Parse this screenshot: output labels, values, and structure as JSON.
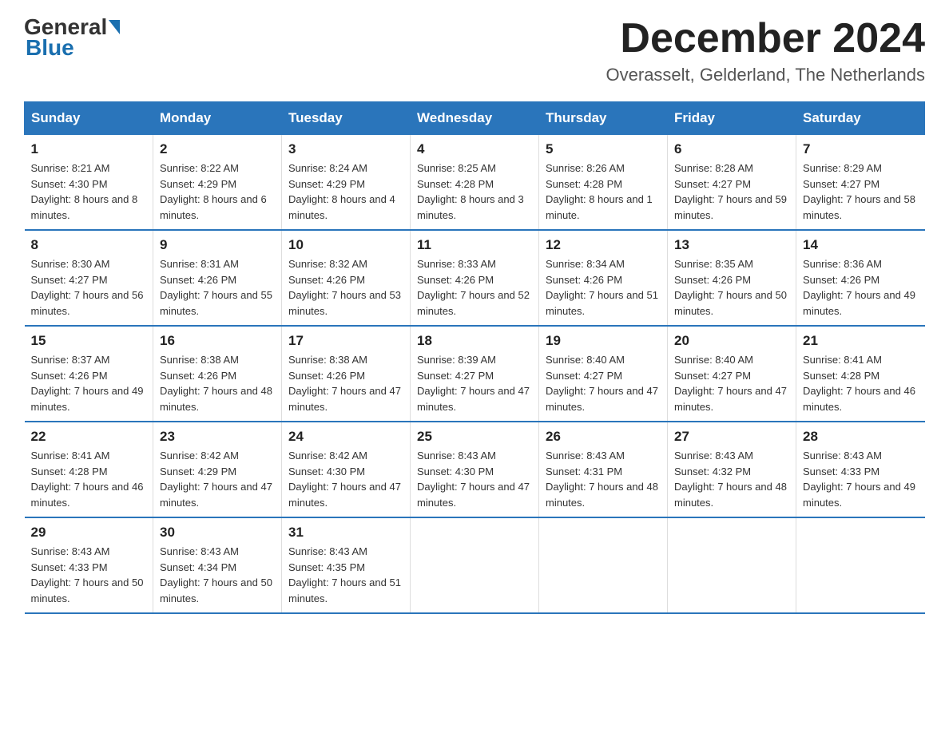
{
  "header": {
    "logo_text": "General",
    "logo_blue": "Blue",
    "month_title": "December 2024",
    "location": "Overasselt, Gelderland, The Netherlands"
  },
  "days_of_week": [
    "Sunday",
    "Monday",
    "Tuesday",
    "Wednesday",
    "Thursday",
    "Friday",
    "Saturday"
  ],
  "weeks": [
    [
      {
        "day": "1",
        "sunrise": "8:21 AM",
        "sunset": "4:30 PM",
        "daylight": "8 hours and 8 minutes."
      },
      {
        "day": "2",
        "sunrise": "8:22 AM",
        "sunset": "4:29 PM",
        "daylight": "8 hours and 6 minutes."
      },
      {
        "day": "3",
        "sunrise": "8:24 AM",
        "sunset": "4:29 PM",
        "daylight": "8 hours and 4 minutes."
      },
      {
        "day": "4",
        "sunrise": "8:25 AM",
        "sunset": "4:28 PM",
        "daylight": "8 hours and 3 minutes."
      },
      {
        "day": "5",
        "sunrise": "8:26 AM",
        "sunset": "4:28 PM",
        "daylight": "8 hours and 1 minute."
      },
      {
        "day": "6",
        "sunrise": "8:28 AM",
        "sunset": "4:27 PM",
        "daylight": "7 hours and 59 minutes."
      },
      {
        "day": "7",
        "sunrise": "8:29 AM",
        "sunset": "4:27 PM",
        "daylight": "7 hours and 58 minutes."
      }
    ],
    [
      {
        "day": "8",
        "sunrise": "8:30 AM",
        "sunset": "4:27 PM",
        "daylight": "7 hours and 56 minutes."
      },
      {
        "day": "9",
        "sunrise": "8:31 AM",
        "sunset": "4:26 PM",
        "daylight": "7 hours and 55 minutes."
      },
      {
        "day": "10",
        "sunrise": "8:32 AM",
        "sunset": "4:26 PM",
        "daylight": "7 hours and 53 minutes."
      },
      {
        "day": "11",
        "sunrise": "8:33 AM",
        "sunset": "4:26 PM",
        "daylight": "7 hours and 52 minutes."
      },
      {
        "day": "12",
        "sunrise": "8:34 AM",
        "sunset": "4:26 PM",
        "daylight": "7 hours and 51 minutes."
      },
      {
        "day": "13",
        "sunrise": "8:35 AM",
        "sunset": "4:26 PM",
        "daylight": "7 hours and 50 minutes."
      },
      {
        "day": "14",
        "sunrise": "8:36 AM",
        "sunset": "4:26 PM",
        "daylight": "7 hours and 49 minutes."
      }
    ],
    [
      {
        "day": "15",
        "sunrise": "8:37 AM",
        "sunset": "4:26 PM",
        "daylight": "7 hours and 49 minutes."
      },
      {
        "day": "16",
        "sunrise": "8:38 AM",
        "sunset": "4:26 PM",
        "daylight": "7 hours and 48 minutes."
      },
      {
        "day": "17",
        "sunrise": "8:38 AM",
        "sunset": "4:26 PM",
        "daylight": "7 hours and 47 minutes."
      },
      {
        "day": "18",
        "sunrise": "8:39 AM",
        "sunset": "4:27 PM",
        "daylight": "7 hours and 47 minutes."
      },
      {
        "day": "19",
        "sunrise": "8:40 AM",
        "sunset": "4:27 PM",
        "daylight": "7 hours and 47 minutes."
      },
      {
        "day": "20",
        "sunrise": "8:40 AM",
        "sunset": "4:27 PM",
        "daylight": "7 hours and 47 minutes."
      },
      {
        "day": "21",
        "sunrise": "8:41 AM",
        "sunset": "4:28 PM",
        "daylight": "7 hours and 46 minutes."
      }
    ],
    [
      {
        "day": "22",
        "sunrise": "8:41 AM",
        "sunset": "4:28 PM",
        "daylight": "7 hours and 46 minutes."
      },
      {
        "day": "23",
        "sunrise": "8:42 AM",
        "sunset": "4:29 PM",
        "daylight": "7 hours and 47 minutes."
      },
      {
        "day": "24",
        "sunrise": "8:42 AM",
        "sunset": "4:30 PM",
        "daylight": "7 hours and 47 minutes."
      },
      {
        "day": "25",
        "sunrise": "8:43 AM",
        "sunset": "4:30 PM",
        "daylight": "7 hours and 47 minutes."
      },
      {
        "day": "26",
        "sunrise": "8:43 AM",
        "sunset": "4:31 PM",
        "daylight": "7 hours and 48 minutes."
      },
      {
        "day": "27",
        "sunrise": "8:43 AM",
        "sunset": "4:32 PM",
        "daylight": "7 hours and 48 minutes."
      },
      {
        "day": "28",
        "sunrise": "8:43 AM",
        "sunset": "4:33 PM",
        "daylight": "7 hours and 49 minutes."
      }
    ],
    [
      {
        "day": "29",
        "sunrise": "8:43 AM",
        "sunset": "4:33 PM",
        "daylight": "7 hours and 50 minutes."
      },
      {
        "day": "30",
        "sunrise": "8:43 AM",
        "sunset": "4:34 PM",
        "daylight": "7 hours and 50 minutes."
      },
      {
        "day": "31",
        "sunrise": "8:43 AM",
        "sunset": "4:35 PM",
        "daylight": "7 hours and 51 minutes."
      },
      null,
      null,
      null,
      null
    ]
  ]
}
